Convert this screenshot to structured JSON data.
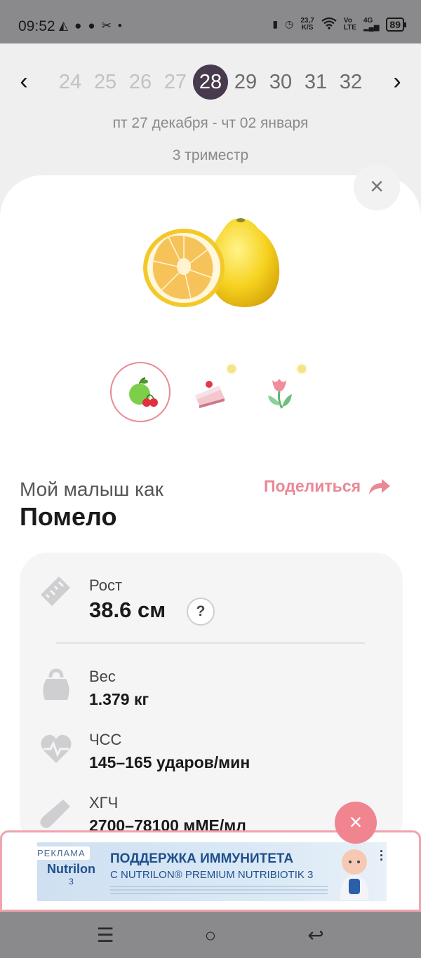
{
  "status_bar": {
    "time": "09:52",
    "net_speed_value": "23,7",
    "net_speed_unit": "K/S",
    "volte_top": "Vo",
    "volte_bottom": "LTE",
    "network": "4G",
    "battery": "89"
  },
  "week_nav": {
    "prev_label": "‹",
    "next_label": "›",
    "weeks": [
      "24",
      "25",
      "26",
      "27",
      "28",
      "29",
      "30",
      "31",
      "32"
    ],
    "current_week": "28"
  },
  "date_range": "пт 27 декабря - чт 02 января",
  "trimester": "3 триместр",
  "close_label": "×",
  "comparison": {
    "icons": [
      "fruit-icon",
      "cake-icon",
      "flower-icon"
    ],
    "active": "fruit-icon"
  },
  "baby_size": {
    "subtitle": "Мой малыш как",
    "fruit_name": "Помело",
    "share_label": "Поделиться"
  },
  "stats": {
    "height": {
      "label": "Рост",
      "value": "38.6 см",
      "help": "?"
    },
    "weight": {
      "label": "Вес",
      "value": "1.379 кг"
    },
    "heart_rate": {
      "label": "ЧСС",
      "value": "145–165 ударов/мин"
    },
    "hcg": {
      "label": "ХГЧ",
      "value": "2700–78100 мМЕ/мл"
    }
  },
  "ad": {
    "close_label": "×",
    "badge": "РЕКЛАМА",
    "brand": "Nutrilon",
    "brand_number": "3",
    "headline": "ПОДДЕРЖКА ИММУНИТЕТА",
    "subheadline": "С NUTRILON® PREMIUM NUTRIBIOTIK 3",
    "colors": {
      "border": "#f0a4ac",
      "close": "#f0858f",
      "brand": "#1f4f8c"
    }
  },
  "colors": {
    "accent": "#ea8895",
    "current_week_bg": "#473a4d"
  }
}
